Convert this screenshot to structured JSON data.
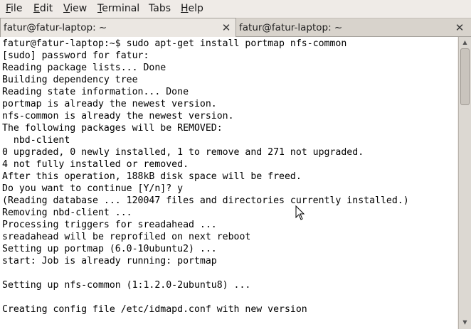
{
  "menubar": {
    "items": [
      {
        "mnemonic": "F",
        "rest": "ile"
      },
      {
        "mnemonic": "E",
        "rest": "dit"
      },
      {
        "mnemonic": "V",
        "rest": "iew"
      },
      {
        "mnemonic": "T",
        "rest": "erminal"
      },
      {
        "mnemonic": "",
        "rest": "Tabs"
      },
      {
        "mnemonic": "H",
        "rest": "elp"
      }
    ]
  },
  "tabs": [
    {
      "label": "fatur@fatur-laptop: ~",
      "close_icon": "close-icon",
      "active": true
    },
    {
      "label": "fatur@fatur-laptop: ~",
      "close_icon": "close-icon",
      "active": false
    }
  ],
  "terminal": {
    "lines": [
      "fatur@fatur-laptop:~$ sudo apt-get install portmap nfs-common",
      "[sudo] password for fatur:",
      "Reading package lists... Done",
      "Building dependency tree",
      "Reading state information... Done",
      "portmap is already the newest version.",
      "nfs-common is already the newest version.",
      "The following packages will be REMOVED:",
      "  nbd-client",
      "0 upgraded, 0 newly installed, 1 to remove and 271 not upgraded.",
      "4 not fully installed or removed.",
      "After this operation, 188kB disk space will be freed.",
      "Do you want to continue [Y/n]? y",
      "(Reading database ... 120047 files and directories currently installed.)",
      "Removing nbd-client ...",
      "Processing triggers for sreadahead ...",
      "sreadahead will be reprofiled on next reboot",
      "Setting up portmap (6.0-10ubuntu2) ...",
      "start: Job is already running: portmap",
      "",
      "Setting up nfs-common (1:1.2.0-2ubuntu8) ...",
      "",
      "Creating config file /etc/idmapd.conf with new version"
    ]
  },
  "scrollbar": {
    "up_icon": "scroll-up-arrow-icon",
    "down_icon": "scroll-down-arrow-icon"
  }
}
